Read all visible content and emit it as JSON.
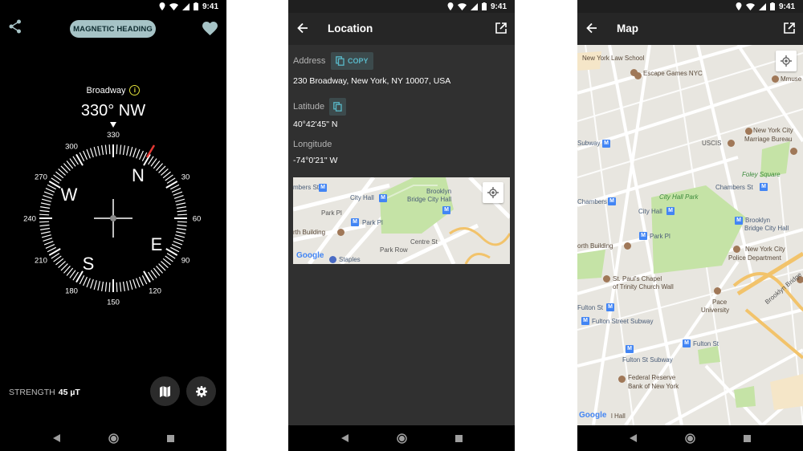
{
  "status": {
    "time": "9:41"
  },
  "compass_screen": {
    "mode_pill": "MAGNETIC HEADING",
    "place_name": "Broadway",
    "heading": "330° NW",
    "heading_tick": "330",
    "dial_numbers": [
      "300",
      "30",
      "60",
      "90",
      "120",
      "150",
      "180",
      "210",
      "240",
      "270"
    ],
    "cardinals": {
      "n": "N",
      "e": "E",
      "s": "S",
      "w": "W"
    },
    "strength_label": "STRENGTH",
    "strength_value": "45 µT",
    "icons": [
      "share-icon",
      "heart-icon",
      "info-icon",
      "map-icon",
      "gear-icon"
    ]
  },
  "location_screen": {
    "title": "Location",
    "address_label": "Address",
    "copy_label": "COPY",
    "address_value": "230 Broadway, New York, NY 10007, USA",
    "latitude_label": "Latitude",
    "latitude_value": "40°42'45\" N",
    "longitude_label": "Longitude",
    "longitude_value": "-74°0'21\" W",
    "map_labels": {
      "chambers": "mbers St",
      "city_hall": "City Hall",
      "brooklyn_bridge_1": "Brooklyn",
      "brooklyn_bridge_2": "Bridge City Hall",
      "park_pl": "Park Pl",
      "park_pl_street": "Park Pl",
      "north_building": "rth Building",
      "park_row": "Park Row",
      "centre_st": "Centre St",
      "staples": "Staples",
      "google": "Google"
    }
  },
  "map_screen": {
    "title": "Map",
    "labels": {
      "law_school": "New York Law School",
      "escape_games": "Escape Games NYC",
      "mmuse": "Mmuse",
      "nyc_marriage_1": "New York City",
      "nyc_marriage_2": "Marriage Bureau",
      "uscis": "USCIS",
      "subway": "Subway",
      "foley_square": "Foley Square",
      "chambers_st_1": "Chambers St",
      "chambers_st_2": "Chambers St",
      "city_hall_park": "City Hall Park",
      "city_hall": "City Hall",
      "bb_city_hall_1": "Brooklyn",
      "bb_city_hall_2": "Bridge City Hall",
      "park_pl": "Park Pl",
      "north_building": "orth Building",
      "nypd_1": "New York City",
      "nypd_2": "Police Department",
      "st_pauls_1": "St. Paul's Chapel",
      "st_pauls_2": "of Trinity Church Wall",
      "pace_1": "Pace",
      "pace_2": "University",
      "fulton_st_1": "Fulton St",
      "fulton_street_subway": "Fulton Street Subway",
      "fulton_st_2": "Fulton St",
      "fulton_st_subway": "Fulton St Subway",
      "fed_1": "Federal Reserve",
      "fed_2": "Bank of New York",
      "brooklyn_bridge": "Brooklyn Bridge",
      "hall": "l Hall",
      "google": "Google"
    }
  },
  "colors": {
    "accent": "#59b8c8",
    "needle": "#e53935",
    "park": "#c5e3a6",
    "road": "#ffffff",
    "metro": "#4285f4"
  }
}
